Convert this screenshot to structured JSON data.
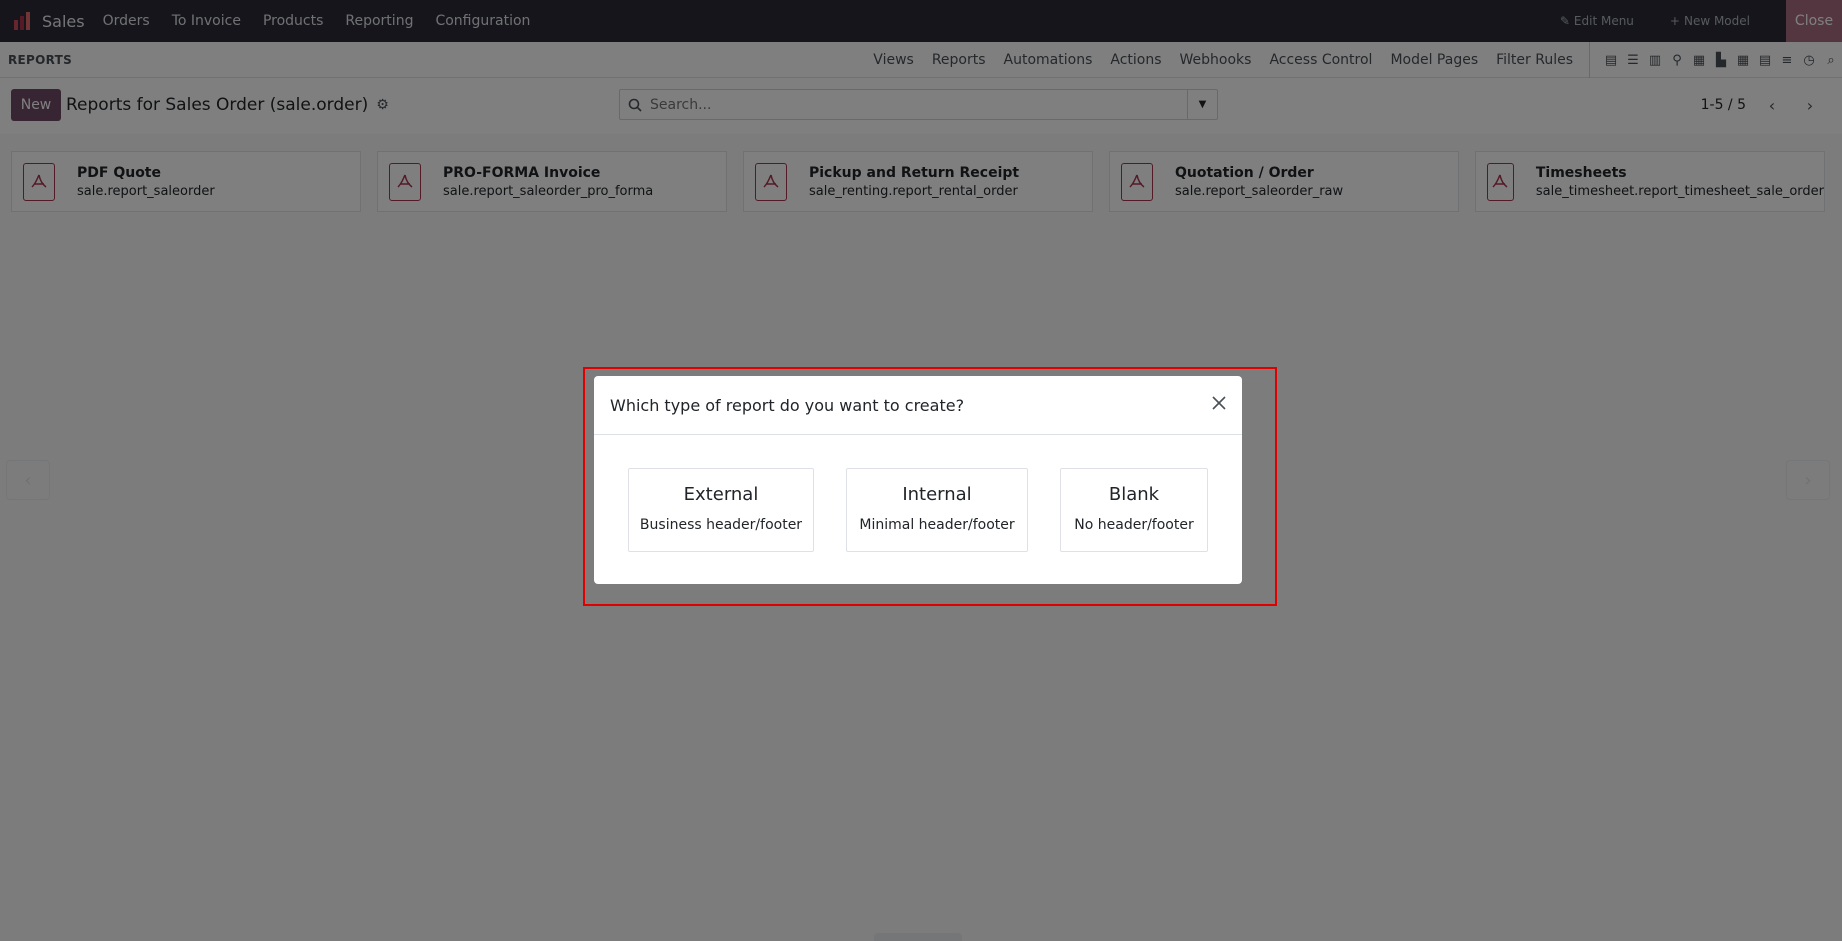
{
  "topbar": {
    "app_name": "Sales",
    "menu": [
      "Orders",
      "To Invoice",
      "Products",
      "Reporting",
      "Configuration"
    ],
    "edit_menu": "Edit Menu",
    "new_model": "New Model",
    "close": "Close"
  },
  "studio": {
    "section": "REPORTS",
    "tabs": [
      "Views",
      "Reports",
      "Automations",
      "Actions",
      "Webhooks",
      "Access Control",
      "Model Pages",
      "Filter Rules"
    ],
    "view_icons": [
      "form-view-icon",
      "list-view-icon",
      "kanban-view-icon",
      "map-view-icon",
      "calendar-view-icon",
      "graph-view-icon",
      "pivot-view-icon",
      "cohort-view-icon",
      "gantt-view-icon",
      "activity-view-icon",
      "search-view-icon"
    ]
  },
  "control": {
    "new_label": "New",
    "title": "Reports for Sales Order (sale.order)",
    "search_placeholder": "Search...",
    "pager": "1-5 / 5"
  },
  "reports": [
    {
      "name": "PDF Quote",
      "technical": "sale.report_saleorder"
    },
    {
      "name": "PRO-FORMA Invoice",
      "technical": "sale.report_saleorder_pro_forma"
    },
    {
      "name": "Pickup and Return Receipt",
      "technical": "sale_renting.report_rental_order"
    },
    {
      "name": "Quotation / Order",
      "technical": "sale.report_saleorder_raw"
    },
    {
      "name": "Timesheets",
      "technical": "sale_timesheet.report_timesheet_sale_order"
    }
  ],
  "modal": {
    "title": "Which type of report do you want to create?",
    "options": [
      {
        "title": "External",
        "subtitle": "Business header/footer"
      },
      {
        "title": "Internal",
        "subtitle": "Minimal header/footer"
      },
      {
        "title": "Blank",
        "subtitle": "No header/footer"
      }
    ]
  },
  "colors": {
    "brand": "#714b67",
    "navbar": "#2a2b36",
    "pdf_icon": "#a9344f",
    "highlight": "#e00000"
  }
}
